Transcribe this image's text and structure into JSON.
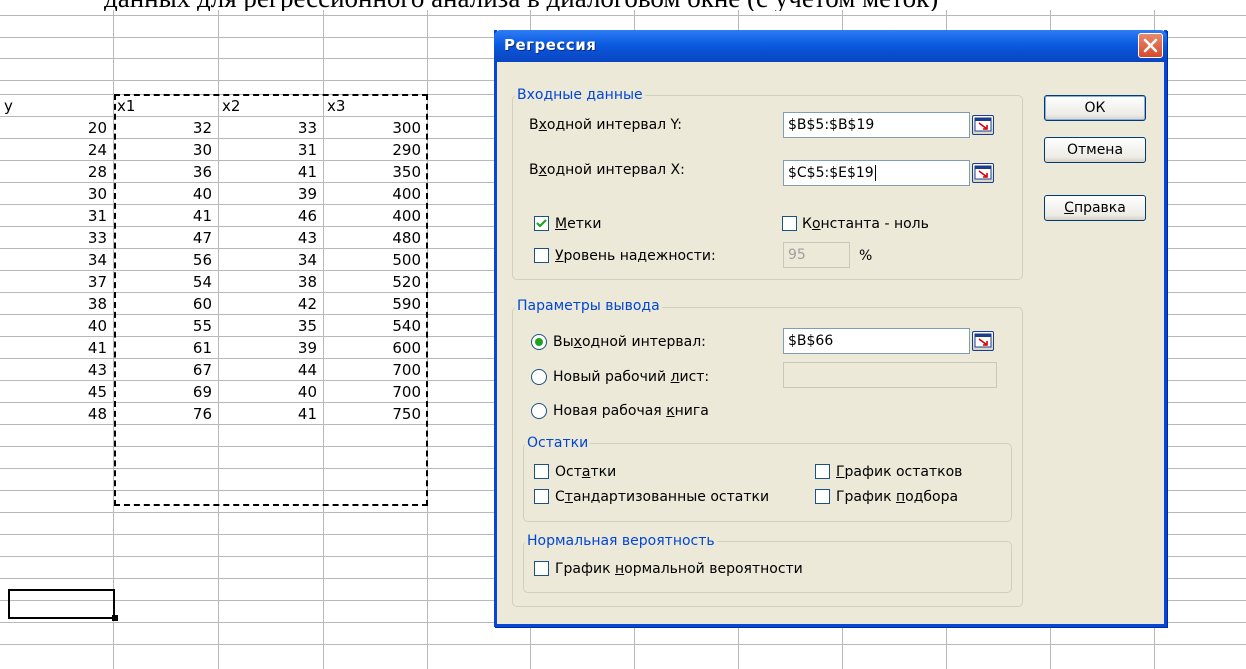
{
  "caption": "данных для регрессионного анализа в диалоговом окне (с учетом меток)",
  "sheet": {
    "headers": [
      "y",
      "x1",
      "x2",
      "x3"
    ],
    "rows": [
      [
        "20",
        "32",
        "33",
        "300"
      ],
      [
        "24",
        "30",
        "31",
        "290"
      ],
      [
        "28",
        "36",
        "41",
        "350"
      ],
      [
        "30",
        "40",
        "39",
        "400"
      ],
      [
        "31",
        "41",
        "46",
        "400"
      ],
      [
        "33",
        "47",
        "43",
        "480"
      ],
      [
        "34",
        "56",
        "34",
        "500"
      ],
      [
        "37",
        "54",
        "38",
        "520"
      ],
      [
        "38",
        "60",
        "42",
        "590"
      ],
      [
        "40",
        "55",
        "35",
        "540"
      ],
      [
        "41",
        "61",
        "39",
        "600"
      ],
      [
        "43",
        "67",
        "44",
        "700"
      ],
      [
        "45",
        "69",
        "40",
        "700"
      ],
      [
        "48",
        "76",
        "41",
        "750"
      ]
    ]
  },
  "dialog": {
    "title": "Регрессия",
    "input_group": {
      "legend": "Входные данные",
      "y_range": {
        "label_pre": "В",
        "label_u": "х",
        "label_post": "одной интервал Y:",
        "value": "$B$5:$B$19"
      },
      "x_range": {
        "label_pre": "В",
        "label_u": "х",
        "label_post": "одной интервал X:",
        "value": "$C$5:$E$19"
      },
      "labels_cb": {
        "label_u": "М",
        "label_post": "етки",
        "checked": true
      },
      "const_zero_cb": {
        "label_pre": "К",
        "label_u": "о",
        "label_post": "нстанта - ноль",
        "checked": false
      },
      "confidence_cb": {
        "label_u": "У",
        "label_post": "ровень надежности:",
        "checked": false
      },
      "confidence_value": "95",
      "percent": "%"
    },
    "output_group": {
      "legend": "Параметры вывода",
      "output_range": {
        "label_pre": "Вы",
        "label_u": "х",
        "label_post": "одной интервал:",
        "value": "$B$66",
        "selected": true
      },
      "new_sheet": {
        "label_pre": "Новый рабочий ",
        "label_u": "л",
        "label_post": "ист:",
        "value": ""
      },
      "new_book": {
        "label_pre": "Новая рабочая ",
        "label_u": "к",
        "label_post": "нига"
      }
    },
    "residuals_group": {
      "legend": "Остатки",
      "residuals": {
        "label_pre": "Ост",
        "label_u": "а",
        "label_post": "тки"
      },
      "std_residuals": {
        "label_pre": "С",
        "label_u": "т",
        "label_post": "андартизованные остатки"
      },
      "residual_plot": {
        "label_u": "Г",
        "label_post": "рафик остатков"
      },
      "fit_plot": {
        "label_pre": "График ",
        "label_u": "п",
        "label_post": "одбора"
      }
    },
    "normal_group": {
      "legend": "Нормальная вероятность",
      "normal_plot": {
        "label_pre": "График ",
        "label_u": "н",
        "label_post": "ормальной вероятности"
      }
    },
    "buttons": {
      "ok": "ОК",
      "cancel": "Отмена",
      "help_u": "С",
      "help_post": "правка"
    }
  }
}
